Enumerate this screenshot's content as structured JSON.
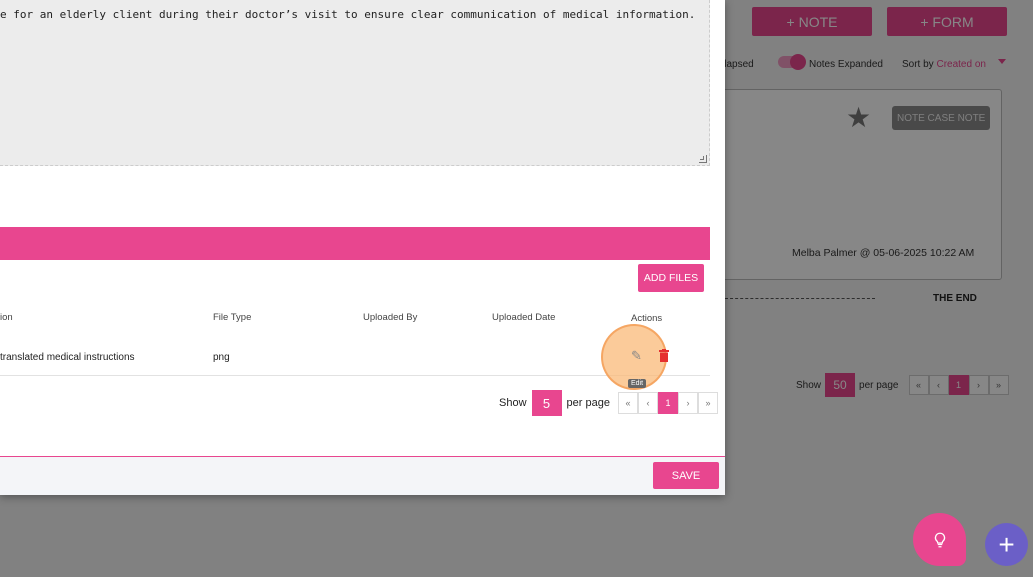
{
  "background": {
    "note_button": "+ NOTE",
    "form_button": "+ FORM",
    "collapsed_label": "llapsed",
    "expanded_label": "Notes Expanded",
    "sort_label": "Sort by",
    "sort_value": "Created on",
    "note_badge": "NOTE CASE NOTE",
    "note_author": "Melba Palmer @ 05-06-2025 10:22 AM",
    "end_label": "THE END",
    "pager": {
      "show_label": "Show",
      "per_page_value": "50",
      "per_page_label": "per page",
      "first": "«",
      "prev": "‹",
      "page": "1",
      "next": "›",
      "last": "»"
    }
  },
  "modal": {
    "description_text": "e for an elderly client during their doctor’s visit to ensure clear communication of medical information.",
    "add_files_button": "ADD FILES",
    "table": {
      "headers": {
        "description": "ion",
        "file_type": "File Type",
        "uploaded_by": "Uploaded By",
        "uploaded_date": "Uploaded Date",
        "actions": "Actions"
      },
      "rows": [
        {
          "description": "translated medical instructions",
          "file_type": "png",
          "uploaded_by": "",
          "uploaded_date": ""
        }
      ]
    },
    "edit_tooltip": "Edit",
    "pager": {
      "show_label": "Show",
      "per_page_value": "5",
      "per_page_label": "per page",
      "first": "«",
      "prev": "‹",
      "page": "1",
      "next": "›",
      "last": "»"
    },
    "save_button": "SAVE"
  },
  "icons": {
    "star": "star-icon",
    "edit": "pencil-icon",
    "delete": "trash-icon",
    "bulb": "lightbulb-icon",
    "plus": "plus-icon"
  },
  "colors": {
    "accent": "#e8468f",
    "fab_secondary": "#6b5fc7",
    "highlight": "#f5a05a"
  }
}
